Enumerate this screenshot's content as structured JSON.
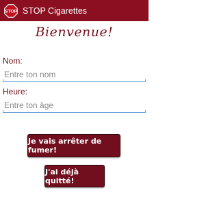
{
  "app": {
    "title": "STOP Cigarettes",
    "icon_name": "stop-sign-icon"
  },
  "welcome": "Bienvenue!",
  "form": {
    "name_label": "Nom:",
    "name_placeholder": "Entre ton nom",
    "name_value": "",
    "age_label": "Heure:",
    "age_placeholder": "Entre ton âge",
    "age_value": ""
  },
  "buttons": {
    "stop_smoking": "Je vais arrêter de fumer!",
    "already_quit": "J'ai déjà quitté!"
  },
  "colors": {
    "action_bar": "#8b0f20",
    "button_bg": "#720f1f",
    "label_text": "#6b0e1a",
    "input_underline": "#6fa4d8"
  }
}
